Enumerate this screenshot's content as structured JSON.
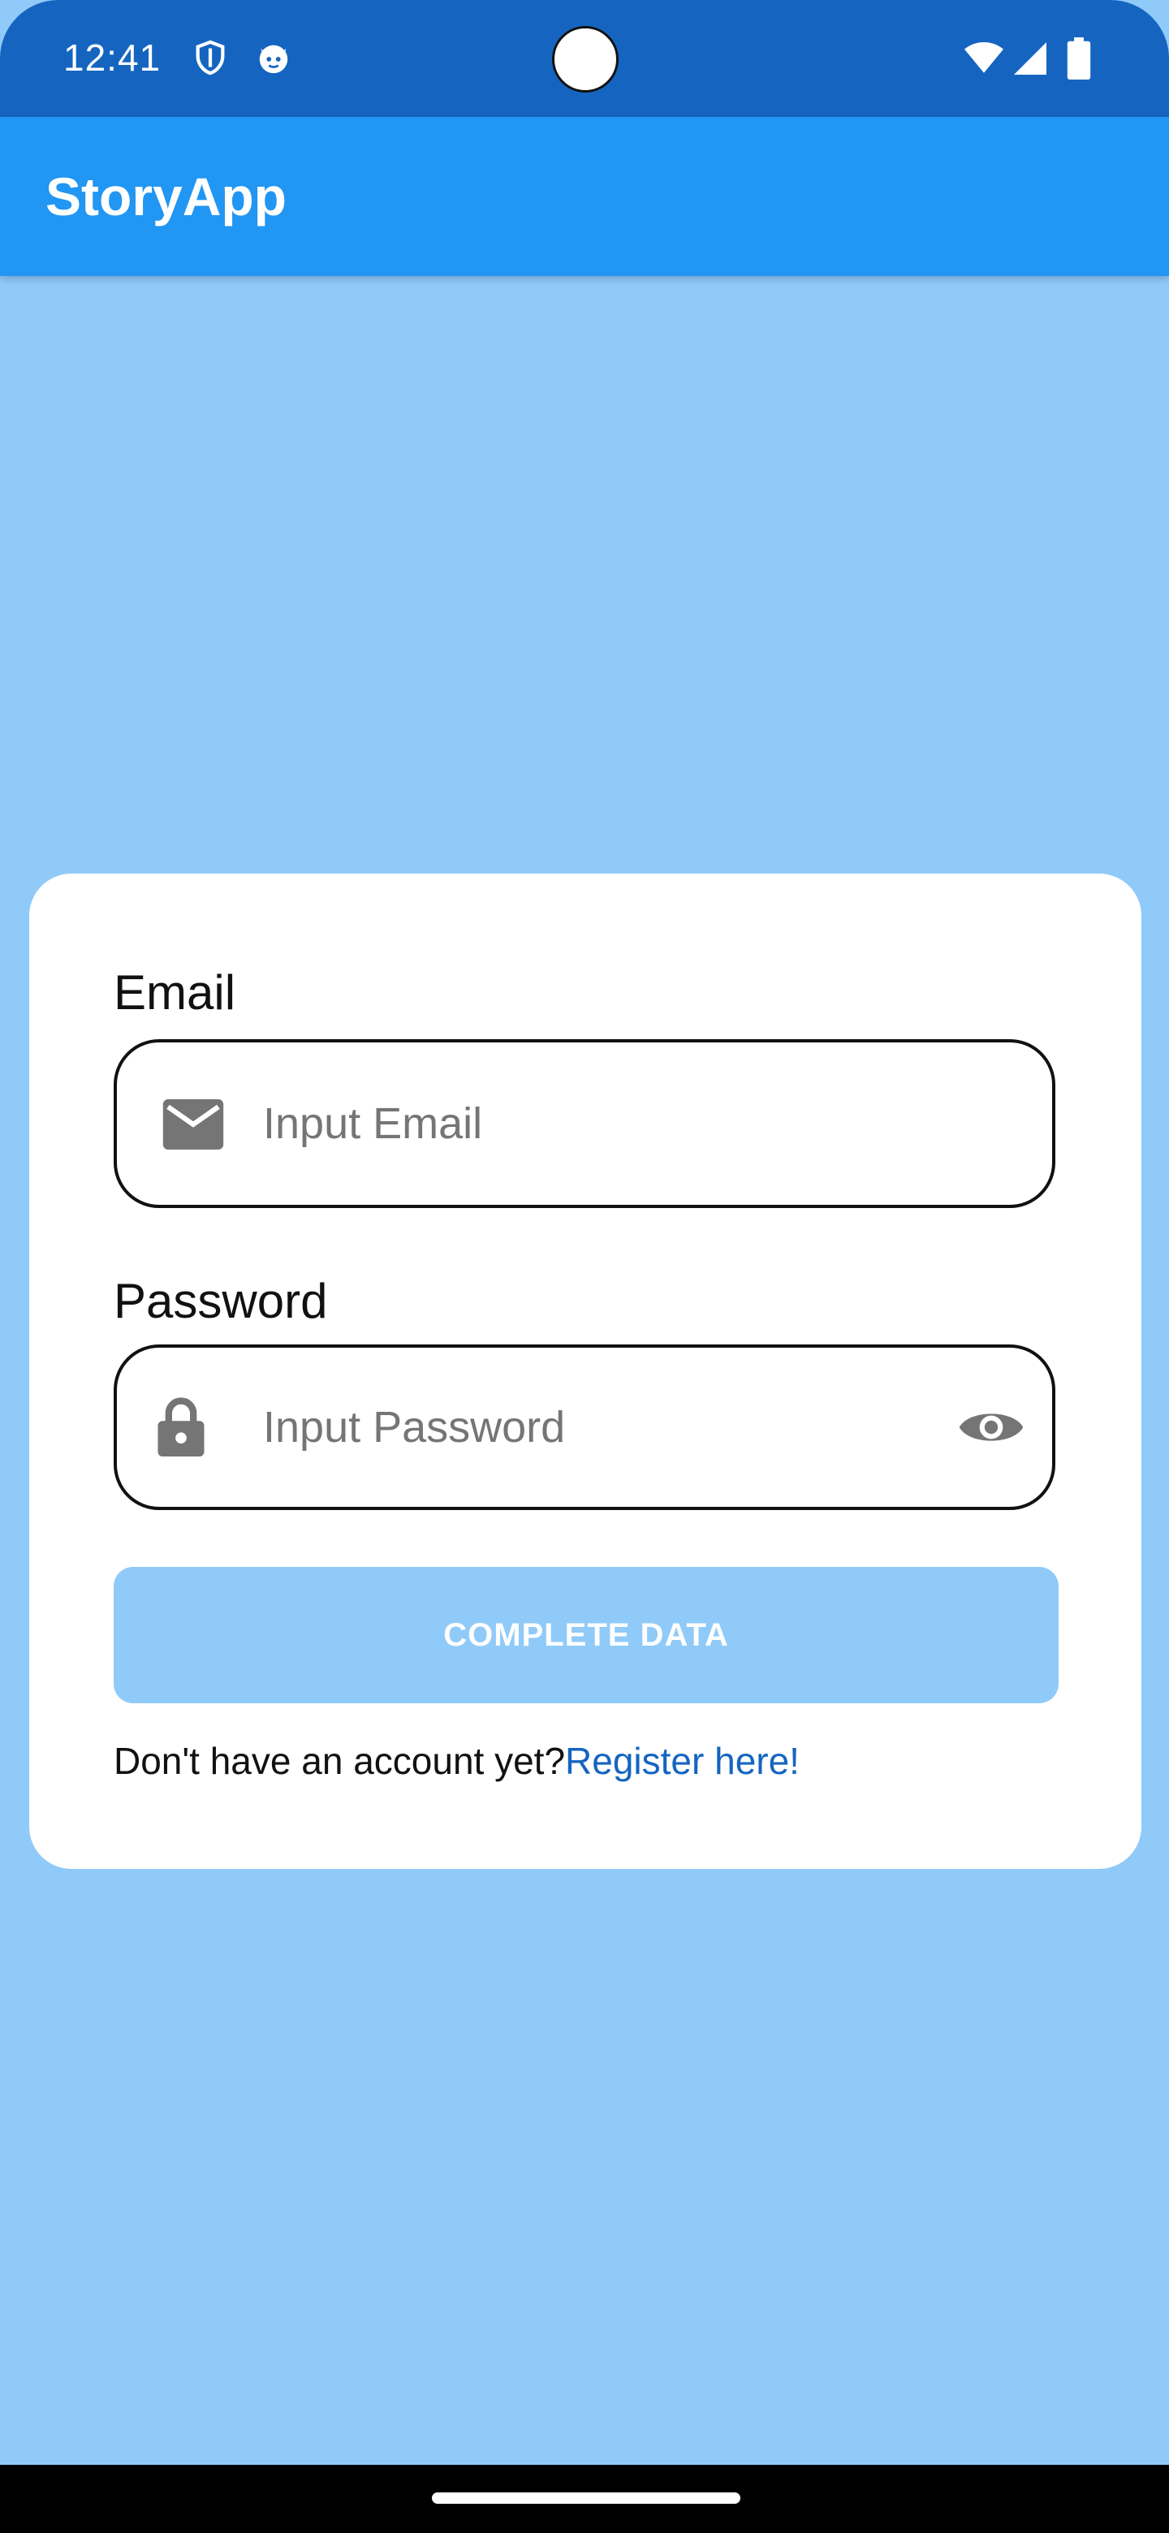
{
  "status_bar": {
    "time": "12:41",
    "left_icons": [
      "shield-icon",
      "cat-icon"
    ],
    "right_icons": [
      "wifi-icon",
      "signal-icon",
      "battery-icon"
    ]
  },
  "app_bar": {
    "title": "StoryApp"
  },
  "login_card": {
    "email": {
      "label": "Email",
      "placeholder": "Input Email",
      "value": "",
      "icon": "mail-icon"
    },
    "password": {
      "label": "Password",
      "placeholder": "Input Password",
      "value": "",
      "icon": "lock-icon",
      "toggle_icon": "eye-icon"
    },
    "submit": {
      "label": "COMPLETE DATA",
      "enabled": false
    },
    "register": {
      "prompt": "Don't have an account yet?",
      "link": "Register here!"
    }
  },
  "colors": {
    "status_bar": "#1565C0",
    "app_bar": "#2196F3",
    "background": "#90CAF9",
    "link": "#1565C0"
  }
}
